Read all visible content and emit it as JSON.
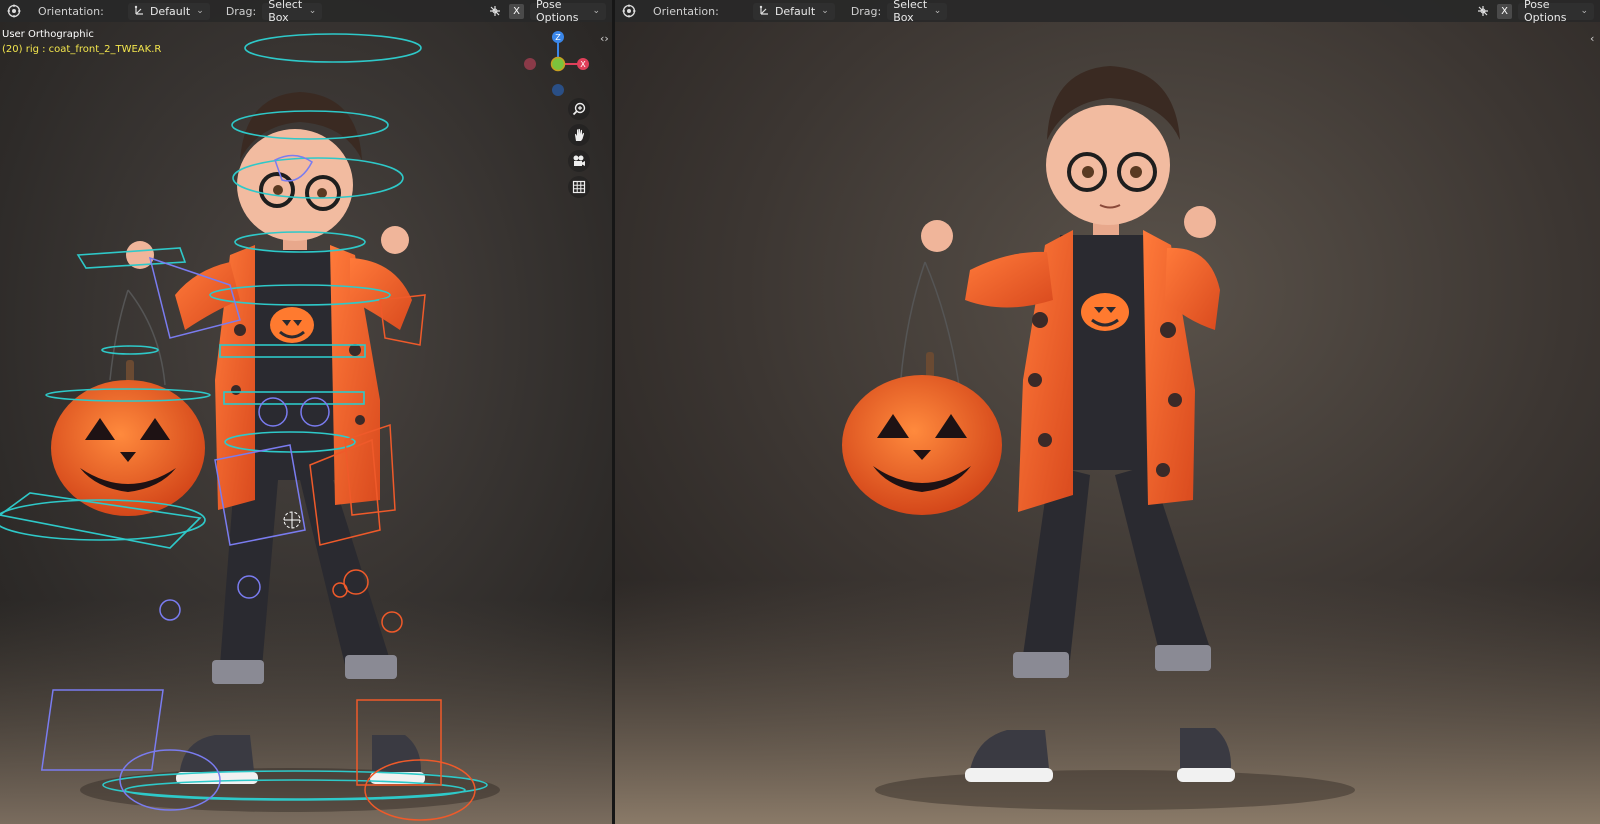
{
  "left_viewport": {
    "header": {
      "orientation_label": "Orientation:",
      "orientation_value": "Default",
      "drag_label": "Drag:",
      "drag_value": "Select Box",
      "x_toggle": "X",
      "pose_options": "Pose Options"
    },
    "view_name": "User Orthographic",
    "active_bone": "(20) rig : coat_front_2_TWEAK.R",
    "gizmo": {
      "z": "Z",
      "x": "X"
    },
    "icons": [
      "viewport-mode-icon",
      "orientation-icon",
      "transform-affect-icon",
      "zoom-icon",
      "hand-icon",
      "camera-icon",
      "grid-icon"
    ]
  },
  "right_viewport": {
    "header": {
      "orientation_label": "Orientation:",
      "orientation_value": "Default",
      "drag_label": "Drag:",
      "drag_value": "Select Box",
      "x_toggle": "X",
      "pose_options": "Pose Options"
    }
  },
  "colors": {
    "header_bg": "#282828",
    "axis_x": "#e0405a",
    "axis_y": "#7cc23c",
    "axis_z": "#3a86e8",
    "rig_cyan": "#2ec9c9",
    "rig_blue": "#7a7cf0",
    "rig_orange": "#ef5a2a",
    "active_text": "#f3e64d"
  }
}
